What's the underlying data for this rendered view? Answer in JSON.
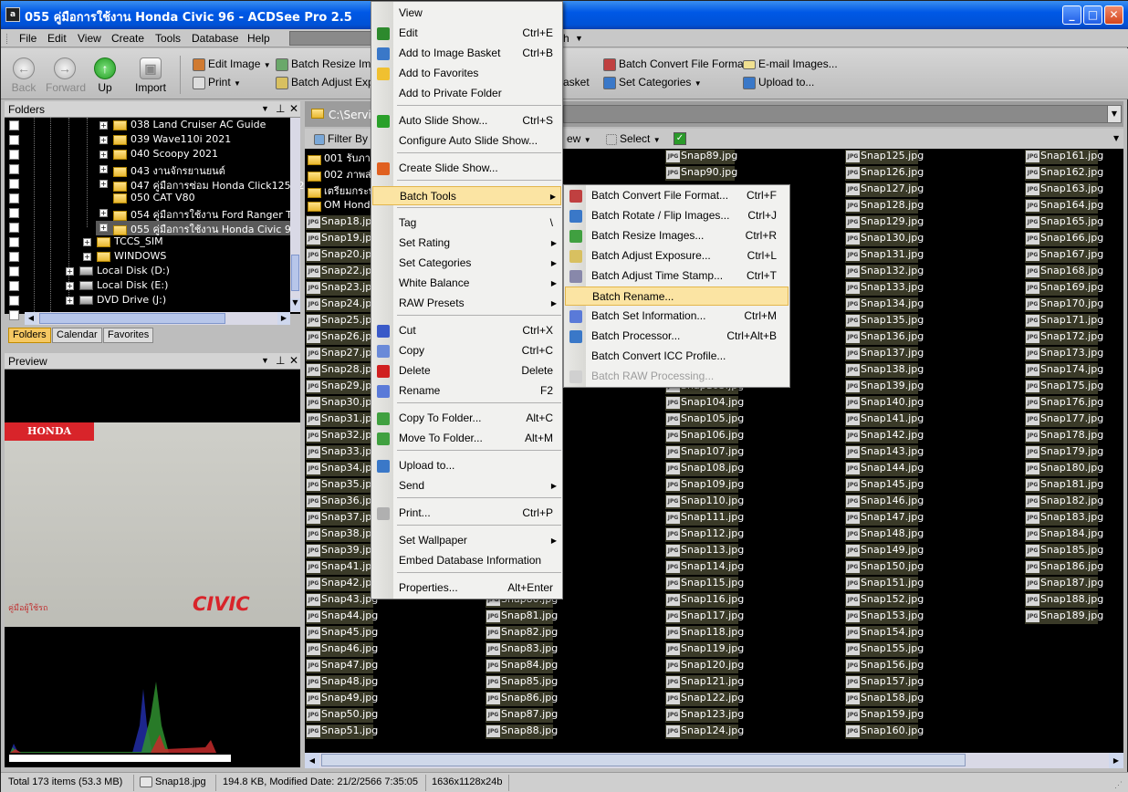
{
  "window": {
    "title": "055 คู่มือการใช้งาน Honda Civic 96 - ACDSee Pro 2.5",
    "app_icon": "ACDSee"
  },
  "menubar": [
    "File",
    "Edit",
    "View",
    "Create",
    "Tools",
    "Database",
    "Help"
  ],
  "menubar_extra": "h",
  "toolbar": {
    "back": "Back",
    "forward": "Forward",
    "up": "Up",
    "import": "Import",
    "edit_image": "Edit Image",
    "print": "Print",
    "batch_resize": "Batch Resize Imag",
    "batch_adjust": "Batch Adjust Expo",
    "basket_tail": "asket",
    "batch_convert": "Batch Convert File Format",
    "set_categories": "Set Categories",
    "email_images": "E-mail Images...",
    "upload_to": "Upload to..."
  },
  "folders_panel": {
    "title": "Folders",
    "items": [
      {
        "label": "038 Land Cruiser AC Guide"
      },
      {
        "label": "039 Wave110i 2021"
      },
      {
        "label": "040 Scoopy 2021"
      },
      {
        "label": "043 งานจักรยานยนต์"
      },
      {
        "label": "047 คู่มือการซ่อม Honda Click125 (2"
      },
      {
        "label": "050 CAT V80"
      },
      {
        "label": "054 คู่มือการใช้งาน Ford Ranger T5"
      },
      {
        "label": "055 คู่มือการใช้งาน Honda Civic 96"
      },
      {
        "label": "TCCS_SIM"
      },
      {
        "label": "WINDOWS"
      },
      {
        "label": "Local Disk (D:)"
      },
      {
        "label": "Local Disk (E:)"
      },
      {
        "label": "DVD Drive (J:)"
      }
    ],
    "tabs": [
      "Folders",
      "Calendar",
      "Favorites"
    ]
  },
  "preview_panel": {
    "title": "Preview",
    "brand": "HONDA",
    "model": "CIVIC",
    "caption": "คู่มือผู้ใช้รถ"
  },
  "browser": {
    "path": "C:\\Servic",
    "filter_by": "Filter By",
    "view_tail": "ew",
    "select": "Select",
    "col1_folders": [
      "001 รับภาพ",
      "002 ภาพส่ว",
      "เตรียมกระษุ",
      "OM Honda"
    ],
    "col1_files": [
      "Snap18.jpg",
      "Snap19.jpg",
      "Snap20.jpg",
      "Snap22.jpg",
      "Snap23.jpg",
      "Snap24.jpg",
      "Snap25.jpg",
      "Snap26.jpg",
      "Snap27.jpg",
      "Snap28.jpg",
      "Snap29.jpg",
      "Snap30.jpg",
      "Snap31.jpg",
      "Snap32.jpg",
      "Snap33.jpg",
      "Snap34.jpg",
      "Snap35.jpg",
      "Snap36.jpg",
      "Snap37.jpg",
      "Snap38.jpg",
      "Snap39.jpg",
      "Snap41.jpg",
      "Snap42.jpg",
      "Snap43.jpg",
      "Snap44.jpg",
      "Snap45.jpg",
      "Snap46.jpg",
      "Snap47.jpg",
      "Snap48.jpg",
      "Snap49.jpg",
      "Snap50.jpg",
      "Snap51.jpg"
    ],
    "col2_files": [
      "Snap80.jpg",
      "Snap81.jpg",
      "Snap82.jpg",
      "Snap83.jpg",
      "Snap84.jpg",
      "Snap85.jpg",
      "Snap86.jpg",
      "Snap87.jpg",
      "Snap88.jpg"
    ],
    "col3_top": [
      "Snap89.jpg",
      "Snap90.jpg"
    ],
    "col3_files": [
      "Snap103.jpg",
      "Snap104.jpg",
      "Snap105.jpg",
      "Snap106.jpg",
      "Snap107.jpg",
      "Snap108.jpg",
      "Snap109.jpg",
      "Snap110.jpg",
      "Snap111.jpg",
      "Snap112.jpg",
      "Snap113.jpg",
      "Snap114.jpg",
      "Snap115.jpg",
      "Snap116.jpg",
      "Snap117.jpg",
      "Snap118.jpg",
      "Snap119.jpg",
      "Snap120.jpg",
      "Snap121.jpg",
      "Snap122.jpg",
      "Snap123.jpg",
      "Snap124.jpg"
    ],
    "col4_files": [
      "Snap125.jpg",
      "Snap126.jpg",
      "Snap127.jpg",
      "Snap128.jpg",
      "Snap129.jpg",
      "Snap130.jpg",
      "Snap131.jpg",
      "Snap132.jpg",
      "Snap133.jpg",
      "Snap134.jpg",
      "Snap135.jpg",
      "Snap136.jpg",
      "Snap137.jpg",
      "Snap138.jpg",
      "Snap139.jpg",
      "Snap140.jpg",
      "Snap141.jpg",
      "Snap142.jpg",
      "Snap143.jpg",
      "Snap144.jpg",
      "Snap145.jpg",
      "Snap146.jpg",
      "Snap147.jpg",
      "Snap148.jpg",
      "Snap149.jpg",
      "Snap150.jpg",
      "Snap151.jpg",
      "Snap152.jpg",
      "Snap153.jpg",
      "Snap154.jpg",
      "Snap155.jpg",
      "Snap156.jpg",
      "Snap157.jpg",
      "Snap158.jpg",
      "Snap159.jpg",
      "Snap160.jpg"
    ],
    "col5_files": [
      "Snap161.jpg",
      "Snap162.jpg",
      "Snap163.jpg",
      "Snap164.jpg",
      "Snap165.jpg",
      "Snap166.jpg",
      "Snap167.jpg",
      "Snap168.jpg",
      "Snap169.jpg",
      "Snap170.jpg",
      "Snap171.jpg",
      "Snap172.jpg",
      "Snap173.jpg",
      "Snap174.jpg",
      "Snap175.jpg",
      "Snap176.jpg",
      "Snap177.jpg",
      "Snap178.jpg",
      "Snap179.jpg",
      "Snap180.jpg",
      "Snap181.jpg",
      "Snap182.jpg",
      "Snap183.jpg",
      "Snap184.jpg",
      "Snap185.jpg",
      "Snap186.jpg",
      "Snap187.jpg",
      "Snap188.jpg",
      "Snap189.jpg"
    ]
  },
  "context_menu": [
    {
      "label": "View",
      "shortcut": ""
    },
    {
      "label": "Edit",
      "shortcut": "Ctrl+E"
    },
    {
      "label": "Add to Image Basket",
      "shortcut": "Ctrl+B"
    },
    {
      "label": "Add to Favorites",
      "shortcut": ""
    },
    {
      "label": "Add to Private Folder",
      "shortcut": ""
    },
    {
      "label": "Auto Slide Show...",
      "shortcut": "Ctrl+S"
    },
    {
      "label": "Configure Auto Slide Show...",
      "shortcut": ""
    },
    {
      "label": "Create Slide Show...",
      "shortcut": ""
    },
    {
      "label": "Batch Tools",
      "shortcut": ""
    },
    {
      "label": "Tag",
      "shortcut": "\\"
    },
    {
      "label": "Set Rating",
      "shortcut": ""
    },
    {
      "label": "Set Categories",
      "shortcut": ""
    },
    {
      "label": "White Balance",
      "shortcut": ""
    },
    {
      "label": "RAW Presets",
      "shortcut": ""
    },
    {
      "label": "Cut",
      "shortcut": "Ctrl+X"
    },
    {
      "label": "Copy",
      "shortcut": "Ctrl+C"
    },
    {
      "label": "Delete",
      "shortcut": "Delete"
    },
    {
      "label": "Rename",
      "shortcut": "F2"
    },
    {
      "label": "Copy To Folder...",
      "shortcut": "Alt+C"
    },
    {
      "label": "Move To Folder...",
      "shortcut": "Alt+M"
    },
    {
      "label": "Upload to...",
      "shortcut": ""
    },
    {
      "label": "Send",
      "shortcut": ""
    },
    {
      "label": "Print...",
      "shortcut": "Ctrl+P"
    },
    {
      "label": "Set Wallpaper",
      "shortcut": ""
    },
    {
      "label": "Embed Database Information",
      "shortcut": ""
    },
    {
      "label": "Properties...",
      "shortcut": "Alt+Enter"
    }
  ],
  "submenu": [
    {
      "label": "Batch Convert File Format...",
      "shortcut": "Ctrl+F"
    },
    {
      "label": "Batch Rotate / Flip Images...",
      "shortcut": "Ctrl+J"
    },
    {
      "label": "Batch Resize Images...",
      "shortcut": "Ctrl+R"
    },
    {
      "label": "Batch Adjust Exposure...",
      "shortcut": "Ctrl+L"
    },
    {
      "label": "Batch Adjust Time Stamp...",
      "shortcut": "Ctrl+T"
    },
    {
      "label": "Batch Rename...",
      "shortcut": ""
    },
    {
      "label": "Batch Set Information...",
      "shortcut": "Ctrl+M"
    },
    {
      "label": "Batch Processor...",
      "shortcut": "Ctrl+Alt+B"
    },
    {
      "label": "Batch Convert ICC Profile...",
      "shortcut": ""
    },
    {
      "label": "Batch RAW Processing...",
      "shortcut": ""
    }
  ],
  "status": {
    "total": "Total 173 items  (53.3 MB)",
    "file": "Snap18.jpg",
    "info": "194.8 KB, Modified Date: 21/2/2566 7:35:05",
    "dims": "1636x1128x24b"
  },
  "colors": {
    "accent": "#0058e6",
    "highlight": "#fbe4a3",
    "thumb_bg": "#3a3a28"
  }
}
